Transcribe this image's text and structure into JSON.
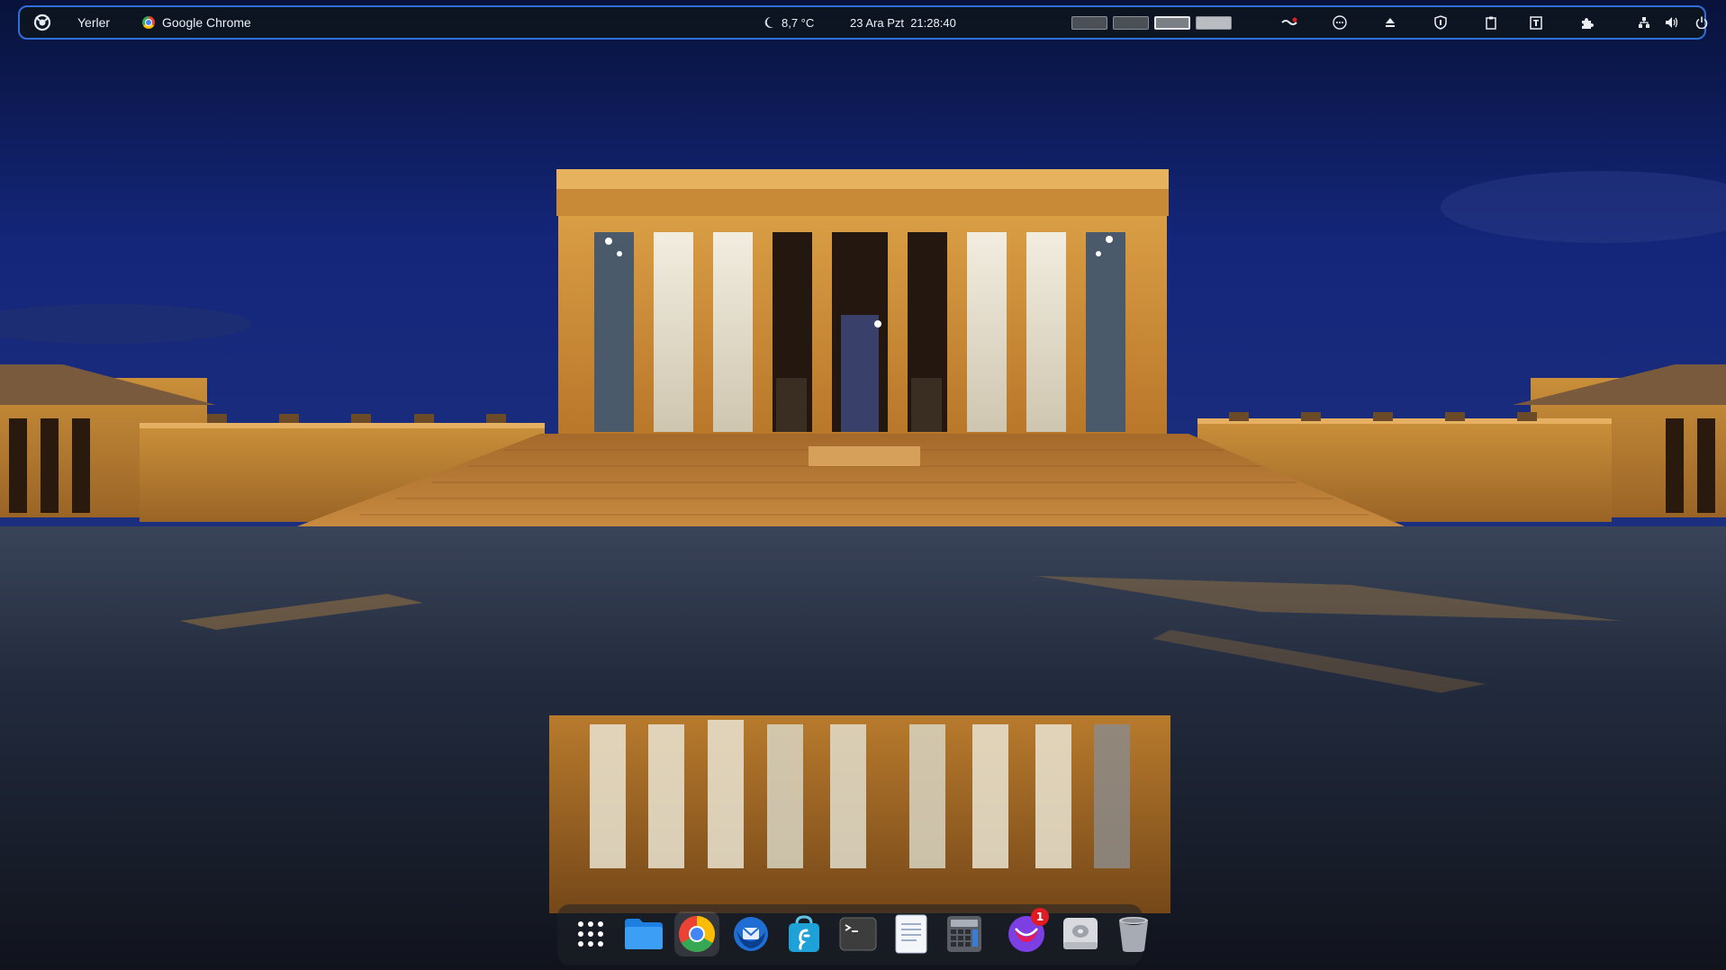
{
  "top_panel": {
    "activities_icon": "debian-swirl-icon",
    "places_label": "Yerler",
    "app_menu": {
      "icon": "chrome-icon",
      "label": "Google Chrome"
    },
    "weather": {
      "icon": "moon-icon",
      "temperature": "8,7 °C"
    },
    "clock": "23 Ara Pzt  21:28:40",
    "workspaces": [
      {
        "active": false
      },
      {
        "active": false
      },
      {
        "active": true
      },
      {
        "active": false
      }
    ],
    "tray_icons": [
      "app-indicator-icon",
      "more-options-icon",
      "eject-icon",
      "shield-icon",
      "clipboard-icon",
      "input-method-icon",
      "extensions-puzzle-icon",
      "network-icon",
      "volume-icon",
      "power-icon"
    ]
  },
  "dock": {
    "items": [
      {
        "name": "app-grid",
        "icon": "app-grid-icon",
        "running": false
      },
      {
        "name": "files",
        "icon": "folder-icon",
        "running": false
      },
      {
        "name": "google-chrome",
        "icon": "chrome-icon",
        "running": true
      },
      {
        "name": "thunderbird",
        "icon": "thunderbird-icon",
        "running": false
      },
      {
        "name": "gnome-software",
        "icon": "software-store-icon",
        "running": false
      },
      {
        "name": "terminal",
        "icon": "terminal-icon",
        "running": false
      },
      {
        "name": "text-editor",
        "icon": "text-editor-icon",
        "running": false
      },
      {
        "name": "calculator",
        "icon": "calculator-icon",
        "running": false
      },
      {
        "name": "messaging-app",
        "icon": "messaging-icon",
        "running": false,
        "badge": "1"
      },
      {
        "name": "disks",
        "icon": "disk-icon",
        "running": false
      },
      {
        "name": "trash",
        "icon": "trash-icon",
        "running": false
      }
    ]
  },
  "colors": {
    "panel_border": "#2f6fd8",
    "sky_top": "#0a1640",
    "monument_light": "#d89a3a",
    "badge": "#e01b24"
  }
}
